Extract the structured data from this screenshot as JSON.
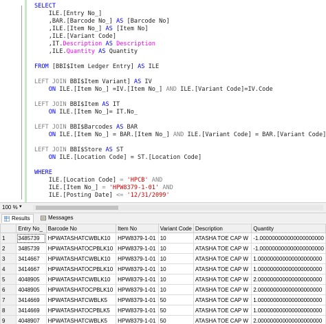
{
  "editor": {
    "lines": [
      [
        {
          "t": "SELECT",
          "c": "kw"
        }
      ],
      [
        {
          "t": "    ILE.[Entry No_]",
          "c": "obj"
        }
      ],
      [
        {
          "t": "    ,BAR.[Barcode No_] ",
          "c": "obj"
        },
        {
          "t": "AS",
          "c": "kw"
        },
        {
          "t": " [Barcode No]",
          "c": "obj"
        }
      ],
      [
        {
          "t": "    ,ILE.[Item No_] ",
          "c": "obj"
        },
        {
          "t": "AS",
          "c": "kw"
        },
        {
          "t": " [Item No]",
          "c": "obj"
        }
      ],
      [
        {
          "t": "    ,ILE.[Variant Code]",
          "c": "obj"
        }
      ],
      [
        {
          "t": "    ,IT.",
          "c": "obj"
        },
        {
          "t": "Description",
          "c": "pink"
        },
        {
          "t": " ",
          "c": "obj"
        },
        {
          "t": "AS",
          "c": "kw"
        },
        {
          "t": " ",
          "c": "obj"
        },
        {
          "t": "Description",
          "c": "pink"
        }
      ],
      [
        {
          "t": "    ,ILE.",
          "c": "obj"
        },
        {
          "t": "Quantity",
          "c": "pink"
        },
        {
          "t": " ",
          "c": "obj"
        },
        {
          "t": "AS",
          "c": "kw"
        },
        {
          "t": " Quantity",
          "c": "obj"
        }
      ],
      [],
      [
        {
          "t": "FROM",
          "c": "kw"
        },
        {
          "t": " [BBI$Item Ledger Entry] ",
          "c": "obj"
        },
        {
          "t": "AS",
          "c": "kw"
        },
        {
          "t": " ILE",
          "c": "obj"
        }
      ],
      [],
      [
        {
          "t": "LEFT JOIN",
          "c": "gray"
        },
        {
          "t": " BBI$Item Variant] ",
          "c": "obj"
        },
        {
          "t": "AS",
          "c": "kw"
        },
        {
          "t": " IV",
          "c": "obj"
        }
      ],
      [
        {
          "t": "    ",
          "c": "obj"
        },
        {
          "t": "ON",
          "c": "kw"
        },
        {
          "t": " ILE.[Item No_] =IV.[Item No_] ",
          "c": "obj"
        },
        {
          "t": "AND",
          "c": "gray"
        },
        {
          "t": " ILE.[Variant Code]=IV.Code",
          "c": "obj"
        }
      ],
      [],
      [
        {
          "t": "LEFT JOIN",
          "c": "gray"
        },
        {
          "t": " BBI$Item ",
          "c": "obj"
        },
        {
          "t": "AS",
          "c": "kw"
        },
        {
          "t": " IT",
          "c": "obj"
        }
      ],
      [
        {
          "t": "    ",
          "c": "obj"
        },
        {
          "t": "ON",
          "c": "kw"
        },
        {
          "t": " ILE.[Item No_]= IT.No_",
          "c": "obj"
        }
      ],
      [],
      [
        {
          "t": "LEFT JOIN",
          "c": "gray"
        },
        {
          "t": " BBI$Barcodes ",
          "c": "obj"
        },
        {
          "t": "AS",
          "c": "kw"
        },
        {
          "t": " BAR",
          "c": "obj"
        }
      ],
      [
        {
          "t": "    ",
          "c": "obj"
        },
        {
          "t": "ON",
          "c": "kw"
        },
        {
          "t": " ILE.[Item No_] = BAR.[Item No_] ",
          "c": "obj"
        },
        {
          "t": "AND",
          "c": "gray"
        },
        {
          "t": " ILE.[Variant Code] = BAR.[Variant Code]",
          "c": "obj"
        }
      ],
      [],
      [
        {
          "t": "LEFT JOIN",
          "c": "gray"
        },
        {
          "t": " BBI$Store ",
          "c": "obj"
        },
        {
          "t": "AS",
          "c": "kw"
        },
        {
          "t": " ST",
          "c": "obj"
        }
      ],
      [
        {
          "t": "    ",
          "c": "obj"
        },
        {
          "t": "ON",
          "c": "kw"
        },
        {
          "t": " ILE.[Location Code] = ST.[Location Code]",
          "c": "obj"
        }
      ],
      [],
      [
        {
          "t": "WHERE",
          "c": "kw"
        }
      ],
      [
        {
          "t": "    ILE.[Location Code] ",
          "c": "obj"
        },
        {
          "t": "=",
          "c": "gray"
        },
        {
          "t": " ",
          "c": "obj"
        },
        {
          "t": "'HPCB'",
          "c": "str"
        },
        {
          "t": " ",
          "c": "obj"
        },
        {
          "t": "AND",
          "c": "gray"
        }
      ],
      [
        {
          "t": "    ILE.[Item No_] ",
          "c": "obj"
        },
        {
          "t": "=",
          "c": "gray"
        },
        {
          "t": " ",
          "c": "obj"
        },
        {
          "t": "'HPW8379-1-01'",
          "c": "str"
        },
        {
          "t": " ",
          "c": "obj"
        },
        {
          "t": "AND",
          "c": "gray"
        }
      ],
      [
        {
          "t": "    ILE.[Posting Date] ",
          "c": "obj"
        },
        {
          "t": "<=",
          "c": "gray"
        },
        {
          "t": " ",
          "c": "obj"
        },
        {
          "t": "'12/31/2099'",
          "c": "str"
        }
      ]
    ]
  },
  "statusbar": {
    "zoom": "100 %"
  },
  "tabs": [
    {
      "label": "Results"
    },
    {
      "label": "Messages"
    }
  ],
  "grid": {
    "columns": [
      "",
      "Entry No_",
      "Barcode No",
      "Item No",
      "Variant Code",
      "Description",
      "Quantity"
    ],
    "rows": [
      [
        "1",
        "3485739",
        "HPWATASHATCWBLK10",
        "HPW8379-1-01",
        "10",
        "ATASHA TOE CAP W",
        "-1.000000000000000000000"
      ],
      [
        "2",
        "3485739",
        "HPWATASHATOCPBLK10",
        "HPW8379-1-01",
        "10",
        "ATASHA TOE CAP W",
        "-1.000000000000000000000"
      ],
      [
        "3",
        "3414667",
        "HPWATASHATCWBLK10",
        "HPW8379-1-01",
        "10",
        "ATASHA TOE CAP W",
        "1.000000000000000000000"
      ],
      [
        "4",
        "3414667",
        "HPWATASHATOCPBLK10",
        "HPW8379-1-01",
        "10",
        "ATASHA TOE CAP W",
        "1.000000000000000000000"
      ],
      [
        "5",
        "4048905",
        "HPWATASHATCWBLK10",
        "HPW8379-1-01",
        "10",
        "ATASHA TOE CAP W",
        "2.000000000000000000000"
      ],
      [
        "6",
        "4048905",
        "HPWATASHATOCPBLK10",
        "HPW8379-1-01",
        "10",
        "ATASHA TOE CAP W",
        "2.000000000000000000000"
      ],
      [
        "7",
        "3414669",
        "HPWATASHATCWBLK5",
        "HPW8379-1-01",
        "50",
        "ATASHA TOE CAP W",
        "1.000000000000000000000"
      ],
      [
        "8",
        "3414669",
        "HPWATASHATOCPBLK5",
        "HPW8379-1-01",
        "50",
        "ATASHA TOE CAP W",
        "1.000000000000000000000"
      ],
      [
        "9",
        "4048907",
        "HPWATASHATCWBLK5",
        "HPW8379-1-01",
        "50",
        "ATASHA TOE CAP W",
        "2.000000000000000000000"
      ],
      [
        "10",
        "4048907",
        "HPWATASHATOCPBLK5",
        "HPW8379-1-01",
        "50",
        "ATASHA TOE CAP W",
        "2.000000000000000000000"
      ]
    ]
  }
}
